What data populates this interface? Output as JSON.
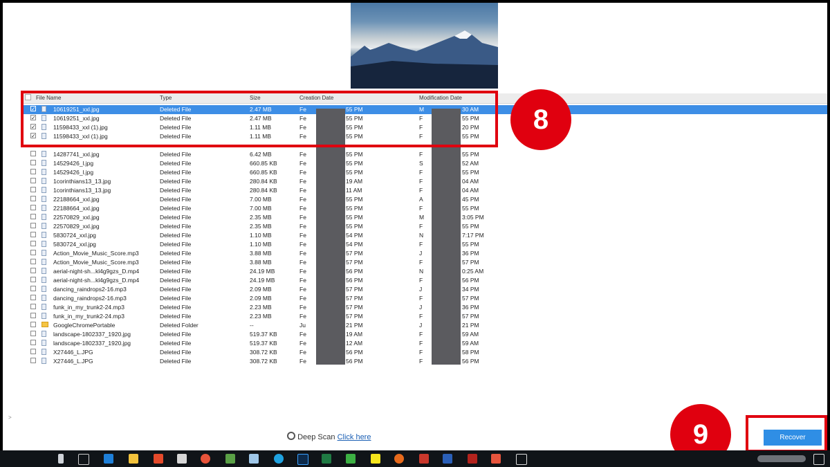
{
  "columns": [
    "File Name",
    "Type",
    "Size",
    "Creation Date",
    "Modification Date"
  ],
  "rows": [
    {
      "name": "10619251_xxl.jpg",
      "type": "Deleted File",
      "size": "2.47 MB",
      "created": "Fe",
      "created_tail": "55 PM",
      "modified": "M",
      "modified_tail": "30 AM",
      "checked": true,
      "selected": true,
      "folder": false
    },
    {
      "name": "10619251_xxl.jpg",
      "type": "Deleted File",
      "size": "2.47 MB",
      "created": "Fe",
      "created_tail": "55 PM",
      "modified": "F",
      "modified_tail": "55 PM",
      "checked": true,
      "selected": false,
      "folder": false
    },
    {
      "name": "11598433_xxl (1).jpg",
      "type": "Deleted File",
      "size": "1.11 MB",
      "created": "Fe",
      "created_tail": "55 PM",
      "modified": "F",
      "modified_tail": "20 PM",
      "checked": true,
      "selected": false,
      "folder": false
    },
    {
      "name": "11598433_xxl (1).jpg",
      "type": "Deleted File",
      "size": "1.11 MB",
      "created": "Fe",
      "created_tail": "55 PM",
      "modified": "F",
      "modified_tail": "55 PM",
      "checked": true,
      "selected": false,
      "folder": false
    },
    {
      "name": "",
      "type": "",
      "size": "",
      "created": "",
      "created_tail": "",
      "modified": "",
      "modified_tail": "",
      "checked": false,
      "selected": false,
      "folder": false,
      "blank": true
    },
    {
      "name": "14287741_xxl.jpg",
      "type": "Deleted File",
      "size": "6.42 MB",
      "created": "Fe",
      "created_tail": "55 PM",
      "modified": "F",
      "modified_tail": "55 PM",
      "checked": false,
      "selected": false,
      "folder": false
    },
    {
      "name": "14529426_l.jpg",
      "type": "Deleted File",
      "size": "660.85 KB",
      "created": "Fe",
      "created_tail": "55 PM",
      "modified": "S",
      "modified_tail": "52 AM",
      "checked": false,
      "selected": false,
      "folder": false
    },
    {
      "name": "14529426_l.jpg",
      "type": "Deleted File",
      "size": "660.85 KB",
      "created": "Fe",
      "created_tail": "55 PM",
      "modified": "F",
      "modified_tail": "55 PM",
      "checked": false,
      "selected": false,
      "folder": false
    },
    {
      "name": "1corinthians13_13.jpg",
      "type": "Deleted File",
      "size": "280.84 KB",
      "created": "Fe",
      "created_tail": "19 AM",
      "modified": "F",
      "modified_tail": "04 AM",
      "checked": false,
      "selected": false,
      "folder": false
    },
    {
      "name": "1corinthians13_13.jpg",
      "type": "Deleted File",
      "size": "280.84 KB",
      "created": "Fe",
      "created_tail": "11 AM",
      "modified": "F",
      "modified_tail": "04 AM",
      "checked": false,
      "selected": false,
      "folder": false
    },
    {
      "name": "22188664_xxl.jpg",
      "type": "Deleted File",
      "size": "7.00 MB",
      "created": "Fe",
      "created_tail": "55 PM",
      "modified": "A",
      "modified_tail": "45 PM",
      "checked": false,
      "selected": false,
      "folder": false
    },
    {
      "name": "22188664_xxl.jpg",
      "type": "Deleted File",
      "size": "7.00 MB",
      "created": "Fe",
      "created_tail": "55 PM",
      "modified": "F",
      "modified_tail": "55 PM",
      "checked": false,
      "selected": false,
      "folder": false
    },
    {
      "name": "22570829_xxl.jpg",
      "type": "Deleted File",
      "size": "2.35 MB",
      "created": "Fe",
      "created_tail": "55 PM",
      "modified": "M",
      "modified_tail": "3:05 PM",
      "checked": false,
      "selected": false,
      "folder": false
    },
    {
      "name": "22570829_xxl.jpg",
      "type": "Deleted File",
      "size": "2.35 MB",
      "created": "Fe",
      "created_tail": "55 PM",
      "modified": "F",
      "modified_tail": "55 PM",
      "checked": false,
      "selected": false,
      "folder": false
    },
    {
      "name": "5830724_xxl.jpg",
      "type": "Deleted File",
      "size": "1.10 MB",
      "created": "Fe",
      "created_tail": "54 PM",
      "modified": "N",
      "modified_tail": "7:17 PM",
      "checked": false,
      "selected": false,
      "folder": false
    },
    {
      "name": "5830724_xxl.jpg",
      "type": "Deleted File",
      "size": "1.10 MB",
      "created": "Fe",
      "created_tail": "54 PM",
      "modified": "F",
      "modified_tail": "55 PM",
      "checked": false,
      "selected": false,
      "folder": false
    },
    {
      "name": "Action_Movie_Music_Score.mp3",
      "type": "Deleted File",
      "size": "3.88 MB",
      "created": "Fe",
      "created_tail": "57 PM",
      "modified": "J",
      "modified_tail": "36 PM",
      "checked": false,
      "selected": false,
      "folder": false
    },
    {
      "name": "Action_Movie_Music_Score.mp3",
      "type": "Deleted File",
      "size": "3.88 MB",
      "created": "Fe",
      "created_tail": "57 PM",
      "modified": "F",
      "modified_tail": "57 PM",
      "checked": false,
      "selected": false,
      "folder": false
    },
    {
      "name": "aerial-night-sh...kl4g9gzs_D.mp4",
      "type": "Deleted File",
      "size": "24.19 MB",
      "created": "Fe",
      "created_tail": "56 PM",
      "modified": "N",
      "modified_tail": "0:25 AM",
      "checked": false,
      "selected": false,
      "folder": false
    },
    {
      "name": "aerial-night-sh...kl4g9gzs_D.mp4",
      "type": "Deleted File",
      "size": "24.19 MB",
      "created": "Fe",
      "created_tail": "56 PM",
      "modified": "F",
      "modified_tail": "56 PM",
      "checked": false,
      "selected": false,
      "folder": false
    },
    {
      "name": "dancing_raindrops2-16.mp3",
      "type": "Deleted File",
      "size": "2.09 MB",
      "created": "Fe",
      "created_tail": "57 PM",
      "modified": "J",
      "modified_tail": "34 PM",
      "checked": false,
      "selected": false,
      "folder": false
    },
    {
      "name": "dancing_raindrops2-16.mp3",
      "type": "Deleted File",
      "size": "2.09 MB",
      "created": "Fe",
      "created_tail": "57 PM",
      "modified": "F",
      "modified_tail": "57 PM",
      "checked": false,
      "selected": false,
      "folder": false
    },
    {
      "name": "funk_in_my_trunk2-24.mp3",
      "type": "Deleted File",
      "size": "2.23 MB",
      "created": "Fe",
      "created_tail": "57 PM",
      "modified": "J",
      "modified_tail": "36 PM",
      "checked": false,
      "selected": false,
      "folder": false
    },
    {
      "name": "funk_in_my_trunk2-24.mp3",
      "type": "Deleted File",
      "size": "2.23 MB",
      "created": "Fe",
      "created_tail": "57 PM",
      "modified": "F",
      "modified_tail": "57 PM",
      "checked": false,
      "selected": false,
      "folder": false
    },
    {
      "name": "GoogleChromePortable",
      "type": "Deleted Folder",
      "size": "--",
      "created": "Ju",
      "created_tail": "21 PM",
      "modified": "J",
      "modified_tail": "21 PM",
      "checked": false,
      "selected": false,
      "folder": true
    },
    {
      "name": "landscape-1802337_1920.jpg",
      "type": "Deleted File",
      "size": "519.37 KB",
      "created": "Fe",
      "created_tail": "19 AM",
      "modified": "F",
      "modified_tail": "59 AM",
      "checked": false,
      "selected": false,
      "folder": false
    },
    {
      "name": "landscape-1802337_1920.jpg",
      "type": "Deleted File",
      "size": "519.37 KB",
      "created": "Fe",
      "created_tail": "12 AM",
      "modified": "F",
      "modified_tail": "59 AM",
      "checked": false,
      "selected": false,
      "folder": false
    },
    {
      "name": "X27446_L.JPG",
      "type": "Deleted File",
      "size": "308.72 KB",
      "created": "Fe",
      "created_tail": "56 PM",
      "modified": "F",
      "modified_tail": "58 PM",
      "checked": false,
      "selected": false,
      "folder": false
    },
    {
      "name": "X27446_L.JPG",
      "type": "Deleted File",
      "size": "308.72 KB",
      "created": "Fe",
      "created_tail": "56 PM",
      "modified": "F",
      "modified_tail": "56 PM",
      "checked": false,
      "selected": false,
      "folder": false
    }
  ],
  "deep_scan": {
    "label": "Deep Scan",
    "link": "Click here"
  },
  "recover_label": "Recover",
  "badges": {
    "step8": "8",
    "step9": "9"
  },
  "colors": {
    "accent": "#2f8ee5",
    "callout": "#e0000f",
    "selection": "#3d8ee6"
  }
}
